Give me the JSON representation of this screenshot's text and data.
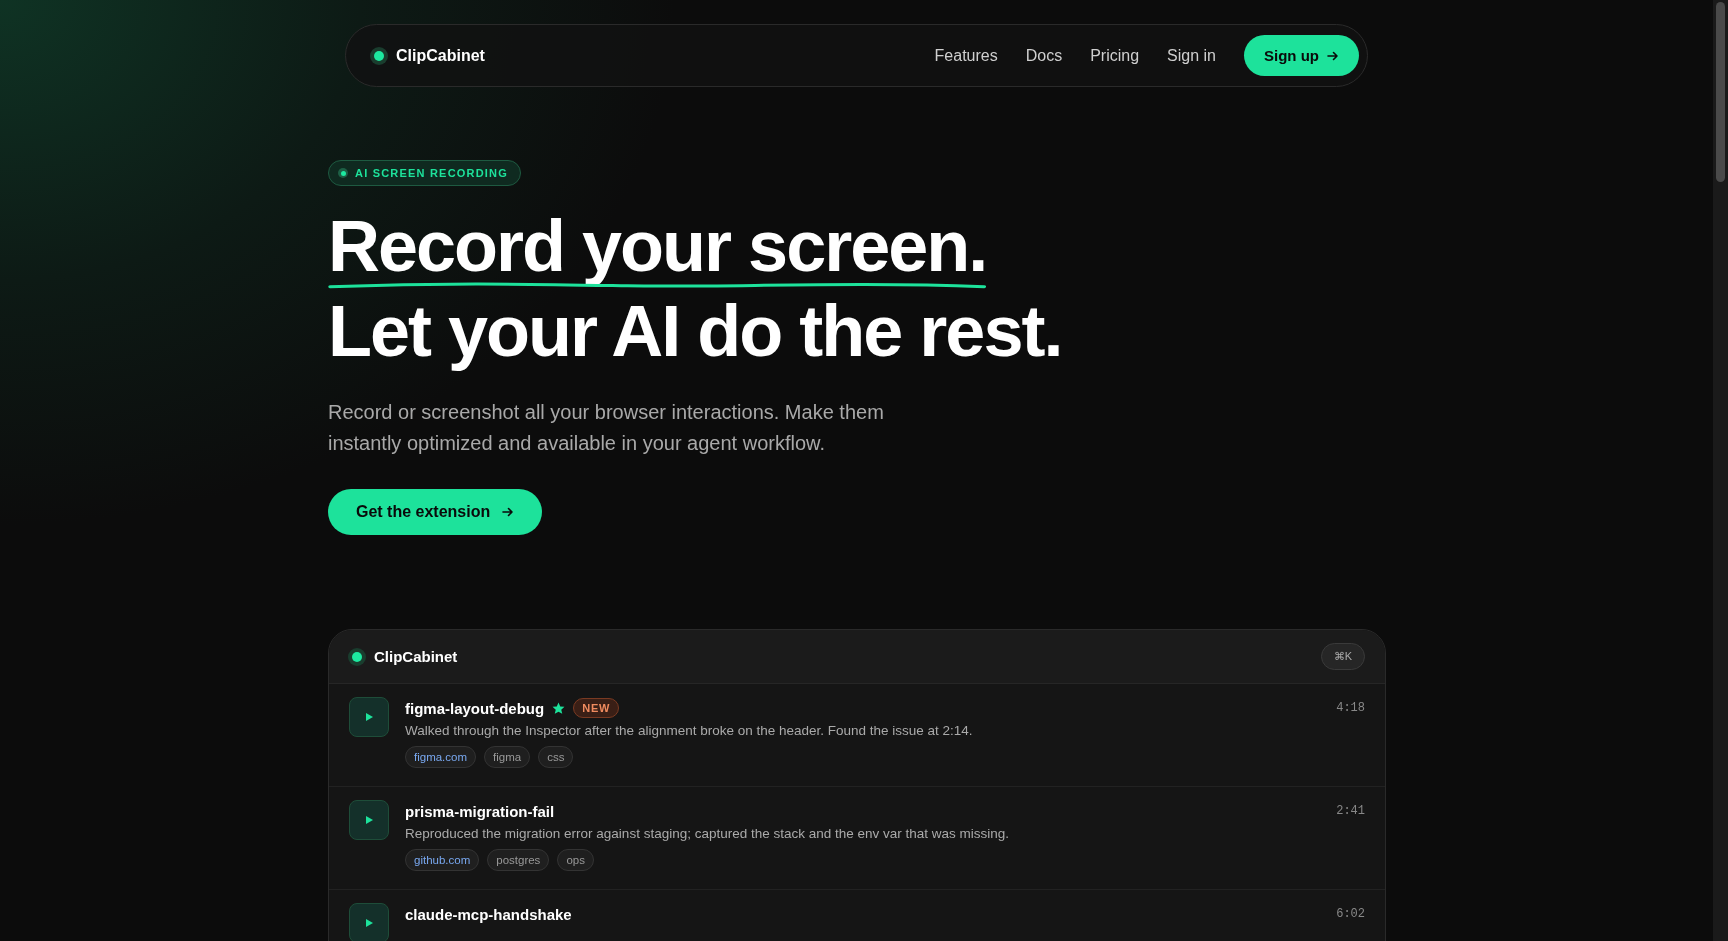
{
  "nav": {
    "brand": "ClipCabinet",
    "links": [
      "Features",
      "Docs",
      "Pricing",
      "Sign in"
    ],
    "cta": "Sign up"
  },
  "hero": {
    "badge": "AI SCREEN RECORDING",
    "headline_1": "Record your screen.",
    "headline_2": "Let your AI do the rest.",
    "paragraph": "Record or screenshot all your browser interactions. Make them instantly optimized and available in your agent workflow.",
    "button": "Get the extension"
  },
  "app": {
    "title": "ClipCabinet",
    "shortcut": "⌘K",
    "clips": [
      {
        "title": "figma-layout-debug",
        "starred": true,
        "badge": "NEW",
        "duration": "4:18",
        "description": "Walked through the Inspector after the alignment broke on the header. Found the issue at 2:14.",
        "tags": [
          {
            "label": "figma.com",
            "kind": "domain"
          },
          {
            "label": "figma",
            "kind": "topic"
          },
          {
            "label": "css",
            "kind": "topic"
          }
        ]
      },
      {
        "title": "prisma-migration-fail",
        "starred": false,
        "duration": "2:41",
        "description": "Reproduced the migration error against staging; captured the stack and the env var that was missing.",
        "tags": [
          {
            "label": "github.com",
            "kind": "domain"
          },
          {
            "label": "postgres",
            "kind": "topic"
          },
          {
            "label": "ops",
            "kind": "topic"
          }
        ]
      },
      {
        "title": "claude-mcp-handshake",
        "starred": false,
        "duration": "6:02"
      }
    ]
  }
}
